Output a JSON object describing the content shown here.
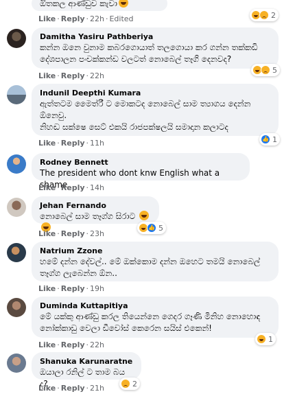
{
  "actions": {
    "like": "Like",
    "reply": "Reply",
    "sep": "·"
  },
  "comments": [
    {
      "author": "",
      "text": "ඔිතකල ආණ්ඩුව කැවා",
      "time": "22h",
      "edited": "Edited",
      "reaction_count": "2"
    },
    {
      "author": "Damitha Yasiru Pathberiya",
      "text": "කන්න ඔනෙ වුනාම කබරගොයාත් තලගොයා කර ගන්න තක්කඩි දේශපාලන පංචක්කන්ඩ වලටත් නොබෙල් තෑගි දෙනවද?",
      "time": "22h",
      "reaction_count": "5"
    },
    {
      "author": "Indunil Deepthi Kumara",
      "text": "ඇත්තටම මෛත්රී ට මොකටද නොබෙල් සාම ත්‍යාගය දෙන්න ඕනෙවු.",
      "text2": "නිහඬ සක්ෂෙ සෙට් එකයි රාජපක්ෂලයි සමාදාන කලාටද",
      "time": "11h",
      "reaction_count": "1"
    },
    {
      "author": "Rodney Bennett",
      "text": "The president who dont knw English what a shame",
      "time": "14h"
    },
    {
      "author": "Jehan Fernando",
      "text": "නොබෙල් සාම තෑග්ග සිරාට",
      "time": "23h",
      "reaction_count": "5"
    },
    {
      "author": "Natrium Zzone",
      "text": "හමේ දන්න දේවල්.. මේ ඔක්කොම දන්න ඔහෙට තමයි නොබෙල් තෑග්ග ලැබෙන්න ඕන..",
      "time": "19h"
    },
    {
      "author": "Duminda Kuttapitiya",
      "text": "මේ යක්කු ආණ්ඩු කරල තියෙන්නෙ ගෙදර ගෑණි මිනිහ නොහොඳ නෝක්කාඩු වෙලා ඩීවෝස් කෙරෙන සයිස් එකෙන්!",
      "time": "22h",
      "reaction_count": "1"
    },
    {
      "author": "Shanuka Karunaratne",
      "text": "ඔයාලා රනිල් ට තාම බය ද?",
      "time": "21h",
      "reaction_count": "2"
    }
  ]
}
